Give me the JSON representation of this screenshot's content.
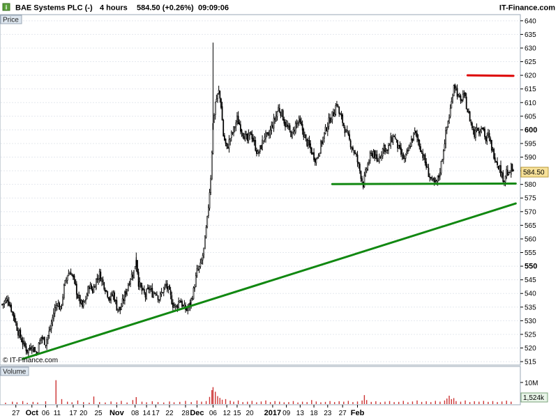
{
  "header": {
    "instrument": "BAE Systems PLC (-)",
    "timeframe": "4 hours",
    "last_price": "584.50 (+0.26%)",
    "time": "09:09:06",
    "brand": "IT-Finance.com"
  },
  "watermark": "© IT-Finance.com",
  "price_panel": {
    "label": "Price",
    "last_price_tag": "584.50"
  },
  "volume_panel": {
    "label": "Volume",
    "tick_10m": "10M",
    "last_volume_tag": "1,524k"
  },
  "chart_data": {
    "type": "candlestick",
    "title": "",
    "x_tick_labels": [
      "27",
      "Oct",
      "06",
      "11",
      "17",
      "20",
      "25",
      "Nov",
      "08",
      "14",
      "17",
      "22",
      "28",
      "Dec",
      "06",
      "12",
      "15",
      "20",
      "2017",
      "09",
      "13",
      "18",
      "23",
      "27",
      "Feb"
    ],
    "x_tick_bold": [
      "Oct",
      "Nov",
      "Dec",
      "2017",
      "Feb"
    ],
    "y_tick_labels": [
      640,
      635,
      630,
      625,
      620,
      615,
      610,
      605,
      600,
      595,
      590,
      585,
      580,
      575,
      570,
      565,
      560,
      555,
      550,
      545,
      540,
      535,
      530,
      525,
      520,
      515
    ],
    "y_tick_bold": [
      600,
      550
    ],
    "ylim": [
      514,
      642
    ],
    "close_path": [
      [
        0,
        536
      ],
      [
        5,
        538
      ],
      [
        10,
        532
      ],
      [
        14,
        526
      ],
      [
        18,
        522
      ],
      [
        22,
        519
      ],
      [
        26,
        521
      ],
      [
        30,
        518
      ],
      [
        34,
        524
      ],
      [
        38,
        522
      ],
      [
        42,
        527
      ],
      [
        45,
        533
      ],
      [
        48,
        537
      ],
      [
        51,
        534
      ],
      [
        54,
        542
      ],
      [
        57,
        547
      ],
      [
        60,
        548
      ],
      [
        63,
        544
      ],
      [
        66,
        539
      ],
      [
        70,
        535
      ],
      [
        73,
        538
      ],
      [
        76,
        543
      ],
      [
        79,
        541
      ],
      [
        82,
        545
      ],
      [
        85,
        547
      ],
      [
        88,
        544
      ],
      [
        91,
        541
      ],
      [
        94,
        538
      ],
      [
        97,
        540
      ],
      [
        100,
        535
      ],
      [
        103,
        534
      ],
      [
        106,
        538
      ],
      [
        109,
        542
      ],
      [
        112,
        546
      ],
      [
        115,
        548
      ],
      [
        117,
        553
      ],
      [
        119,
        544
      ],
      [
        122,
        541
      ],
      [
        125,
        539
      ],
      [
        128,
        542
      ],
      [
        131,
        540
      ],
      [
        134,
        541
      ],
      [
        137,
        538
      ],
      [
        140,
        541
      ],
      [
        143,
        543
      ],
      [
        146,
        540
      ],
      [
        149,
        536
      ],
      [
        152,
        535
      ],
      [
        155,
        538
      ],
      [
        158,
        535
      ],
      [
        161,
        534
      ],
      [
        164,
        536
      ],
      [
        167,
        541
      ],
      [
        170,
        548
      ],
      [
        173,
        550
      ],
      [
        176,
        556
      ],
      [
        179,
        567
      ],
      [
        182,
        583
      ],
      [
        184,
        602
      ],
      [
        186,
        610
      ],
      [
        189,
        614
      ],
      [
        191,
        609
      ],
      [
        193,
        598
      ],
      [
        196,
        593
      ],
      [
        199,
        597
      ],
      [
        202,
        600
      ],
      [
        205,
        604
      ],
      [
        208,
        601
      ],
      [
        211,
        598
      ],
      [
        214,
        596
      ],
      [
        217,
        599
      ],
      [
        220,
        595
      ],
      [
        223,
        591
      ],
      [
        226,
        594
      ],
      [
        229,
        598
      ],
      [
        232,
        597
      ],
      [
        235,
        601
      ],
      [
        238,
        604
      ],
      [
        241,
        608
      ],
      [
        244,
        606
      ],
      [
        247,
        602
      ],
      [
        250,
        600
      ],
      [
        253,
        598
      ],
      [
        256,
        602
      ],
      [
        259,
        603
      ],
      [
        262,
        600
      ],
      [
        265,
        596
      ],
      [
        268,
        594
      ],
      [
        271,
        591
      ],
      [
        274,
        589
      ],
      [
        277,
        593
      ],
      [
        280,
        597
      ],
      [
        283,
        601
      ],
      [
        286,
        604
      ],
      [
        289,
        606
      ],
      [
        292,
        610
      ],
      [
        294,
        606
      ],
      [
        297,
        603
      ],
      [
        300,
        599
      ],
      [
        303,
        596
      ],
      [
        306,
        593
      ],
      [
        309,
        590
      ],
      [
        312,
        585
      ],
      [
        315,
        580
      ],
      [
        318,
        586
      ],
      [
        321,
        590
      ],
      [
        324,
        592
      ],
      [
        327,
        588
      ],
      [
        330,
        591
      ],
      [
        333,
        594
      ],
      [
        336,
        592
      ],
      [
        339,
        596
      ],
      [
        342,
        598
      ],
      [
        345,
        594
      ],
      [
        348,
        591
      ],
      [
        351,
        589
      ],
      [
        354,
        592
      ],
      [
        357,
        596
      ],
      [
        360,
        599
      ],
      [
        363,
        596
      ],
      [
        366,
        592
      ],
      [
        369,
        588
      ],
      [
        372,
        584
      ],
      [
        375,
        581
      ],
      [
        378,
        580
      ],
      [
        381,
        583
      ],
      [
        384,
        590
      ],
      [
        386,
        596
      ],
      [
        388,
        601
      ],
      [
        390,
        605
      ],
      [
        392,
        610
      ],
      [
        394,
        617
      ],
      [
        396,
        615
      ],
      [
        398,
        612
      ],
      [
        400,
        610
      ],
      [
        402,
        613
      ],
      [
        404,
        611
      ],
      [
        406,
        607
      ],
      [
        408,
        604
      ],
      [
        410,
        601
      ],
      [
        412,
        598
      ],
      [
        414,
        602
      ],
      [
        416,
        599
      ],
      [
        418,
        602
      ],
      [
        420,
        600
      ],
      [
        422,
        596
      ],
      [
        424,
        598
      ],
      [
        426,
        595
      ],
      [
        428,
        592
      ],
      [
        430,
        590
      ],
      [
        432,
        588
      ],
      [
        434,
        586
      ],
      [
        436,
        583
      ],
      [
        438,
        582
      ],
      [
        440,
        585
      ],
      [
        442,
        583
      ],
      [
        444,
        586
      ],
      [
        446,
        584
      ]
    ],
    "volume_bars": [
      [
        3,
        0.7
      ],
      [
        9,
        1.2
      ],
      [
        13,
        0.9
      ],
      [
        18,
        1.5
      ],
      [
        22,
        0.6
      ],
      [
        27,
        1.1
      ],
      [
        31,
        0.8
      ],
      [
        38,
        1.4
      ],
      [
        47,
        12.0
      ],
      [
        52,
        2.5
      ],
      [
        57,
        1.2
      ],
      [
        61,
        0.9
      ],
      [
        66,
        1.8
      ],
      [
        71,
        1.0
      ],
      [
        76,
        0.7
      ],
      [
        80,
        3.8
      ],
      [
        85,
        1.0
      ],
      [
        90,
        0.8
      ],
      [
        95,
        1.3
      ],
      [
        100,
        0.9
      ],
      [
        104,
        1.6
      ],
      [
        109,
        0.8
      ],
      [
        114,
        2.0
      ],
      [
        117,
        3.5
      ],
      [
        122,
        1.2
      ],
      [
        126,
        0.9
      ],
      [
        131,
        1.4
      ],
      [
        136,
        1.0
      ],
      [
        141,
        0.8
      ],
      [
        146,
        1.3
      ],
      [
        150,
        0.9
      ],
      [
        155,
        1.1
      ],
      [
        160,
        1.6
      ],
      [
        165,
        1.0
      ],
      [
        170,
        1.8
      ],
      [
        174,
        1.2
      ],
      [
        178,
        1.5
      ],
      [
        181,
        3.6
      ],
      [
        183,
        7.0
      ],
      [
        184,
        8.5
      ],
      [
        186,
        6.2
      ],
      [
        188,
        4.0
      ],
      [
        190,
        3.1
      ],
      [
        192,
        2.2
      ],
      [
        195,
        2.5
      ],
      [
        199,
        1.7
      ],
      [
        202,
        1.2
      ],
      [
        206,
        1.8
      ],
      [
        210,
        1.0
      ],
      [
        214,
        1.2
      ],
      [
        218,
        1.6
      ],
      [
        222,
        0.9
      ],
      [
        226,
        1.3
      ],
      [
        230,
        1.8
      ],
      [
        234,
        1.0
      ],
      [
        238,
        1.5
      ],
      [
        242,
        1.2
      ],
      [
        246,
        0.9
      ],
      [
        250,
        1.0
      ],
      [
        254,
        1.5
      ],
      [
        258,
        0.8
      ],
      [
        262,
        1.2
      ],
      [
        266,
        1.0
      ],
      [
        270,
        2.0
      ],
      [
        274,
        1.3
      ],
      [
        278,
        0.9
      ],
      [
        282,
        1.1
      ],
      [
        286,
        1.5
      ],
      [
        290,
        1.0
      ],
      [
        294,
        1.4
      ],
      [
        298,
        1.2
      ],
      [
        302,
        1.6
      ],
      [
        306,
        1.0
      ],
      [
        310,
        1.3
      ],
      [
        314,
        1.8
      ],
      [
        316,
        4.5
      ],
      [
        318,
        2.0
      ],
      [
        322,
        1.1
      ],
      [
        326,
        1.4
      ],
      [
        330,
        0.9
      ],
      [
        334,
        1.2
      ],
      [
        338,
        1.5
      ],
      [
        342,
        1.0
      ],
      [
        346,
        1.1
      ],
      [
        350,
        1.6
      ],
      [
        354,
        0.9
      ],
      [
        358,
        1.3
      ],
      [
        362,
        1.8
      ],
      [
        366,
        1.1
      ],
      [
        370,
        1.4
      ],
      [
        374,
        1.0
      ],
      [
        378,
        1.6
      ],
      [
        382,
        1.2
      ],
      [
        386,
        1.8
      ],
      [
        388,
        2.8
      ],
      [
        390,
        4.2
      ],
      [
        392,
        2.5
      ],
      [
        394,
        3.0
      ],
      [
        396,
        1.5
      ],
      [
        400,
        1.2
      ],
      [
        404,
        1.8
      ],
      [
        408,
        1.0
      ],
      [
        412,
        1.4
      ],
      [
        416,
        1.2
      ],
      [
        420,
        1.6
      ],
      [
        424,
        1.1
      ],
      [
        428,
        1.5
      ],
      [
        432,
        1.0
      ],
      [
        436,
        1.3
      ],
      [
        440,
        1.7
      ],
      [
        444,
        1.2
      ]
    ],
    "volume_ylim": [
      0,
      14
    ],
    "trend_lines": [
      {
        "color": "#dd0000",
        "points": [
          [
            406,
            620
          ],
          [
            446,
            619.8
          ]
        ]
      },
      {
        "color": "#118811",
        "points": [
          [
            288,
            580.1
          ],
          [
            448,
            580.3
          ]
        ]
      },
      {
        "color": "#118811",
        "points": [
          [
            18,
            516
          ],
          [
            448,
            573
          ]
        ]
      }
    ],
    "grid": true,
    "n_bars": 450,
    "colors": {
      "up": "#000000",
      "down": "#000000",
      "body_up": "#ffffff",
      "body_down": "#000000",
      "volume": "#cc3333",
      "panel_border": "#9aa7b5",
      "label_bg": "#dde6ef",
      "last_tag_bg": "#f7e199",
      "volume_tag_bg": "#e8f4e8",
      "trend_green": "#118811",
      "trend_red": "#dd0000"
    }
  }
}
